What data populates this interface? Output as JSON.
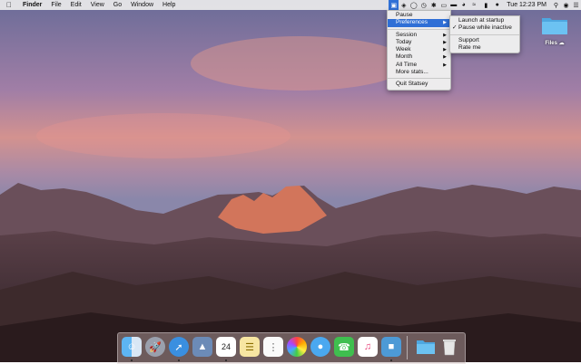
{
  "menubar": {
    "app_name": "Finder",
    "items": [
      "File",
      "Edit",
      "View",
      "Go",
      "Window",
      "Help"
    ],
    "clock": "Tue 12:23 PM"
  },
  "statsey_menu": {
    "pause": "Pause",
    "preferences": "Preferences",
    "session": "Session",
    "today": "Today",
    "week": "Week",
    "month": "Month",
    "all_time": "All Time",
    "more_stats": "More stats...",
    "quit": "Quit Statsey"
  },
  "preferences_submenu": {
    "launch_at_startup": "Launch at startup",
    "pause_while_inactive": "Pause while inactive",
    "pause_while_inactive_checked": true,
    "support": "Support",
    "rate_me": "Rate me"
  },
  "desktop": {
    "files_label": "Files"
  },
  "dock": {
    "apps": [
      "finder-icon",
      "launchpad-icon",
      "safari-icon",
      "photo-preview-icon",
      "calendar-icon",
      "notes-icon",
      "reminders-icon",
      "photos-icon",
      "messages-icon",
      "facetime-icon",
      "itunes-icon",
      "statsey-icon",
      "folder-icon",
      "trash-icon"
    ],
    "calendar_day": "24"
  },
  "colors": {
    "highlight": "#2f6fd6",
    "folder_blue": "#5fb7ec"
  }
}
